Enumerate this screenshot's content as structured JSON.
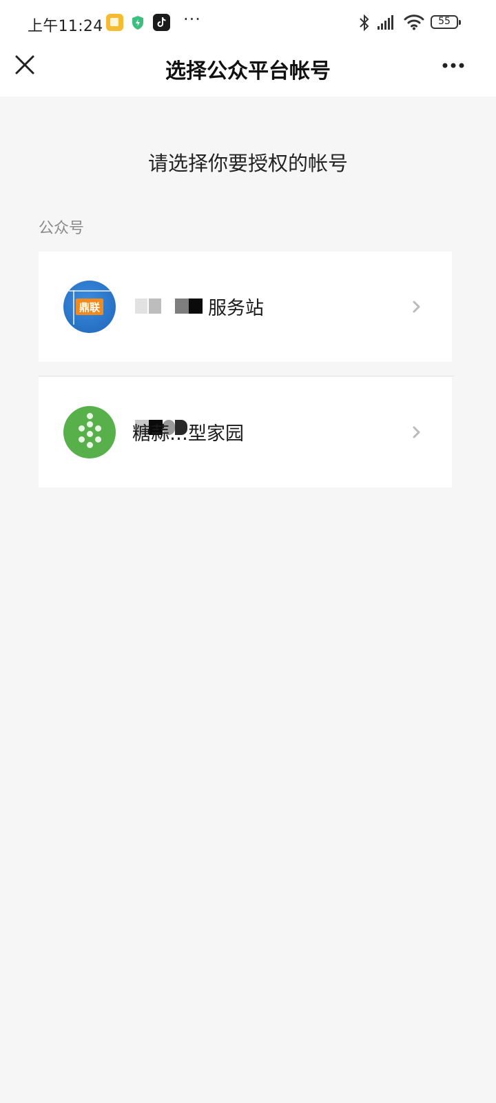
{
  "status_bar": {
    "time": "上午11:24",
    "more": "···",
    "battery": "55"
  },
  "nav": {
    "title": "选择公众平台帐号"
  },
  "prompt": "请选择你要授权的帐号",
  "section_label": "公众号",
  "accounts": [
    {
      "name_visible": "服务站",
      "avatar_color": "#2878d0",
      "avatar_text": "鼎联",
      "icon": "chevron-right-icon"
    },
    {
      "name_visible": "糖蒜…型家园",
      "avatar_color": "#57b04a",
      "icon": "chevron-right-icon"
    }
  ],
  "colors": {
    "background": "#f6f6f6",
    "card": "#ffffff",
    "section_label": "#8a8a8a",
    "chevron": "#bbbbbb"
  }
}
